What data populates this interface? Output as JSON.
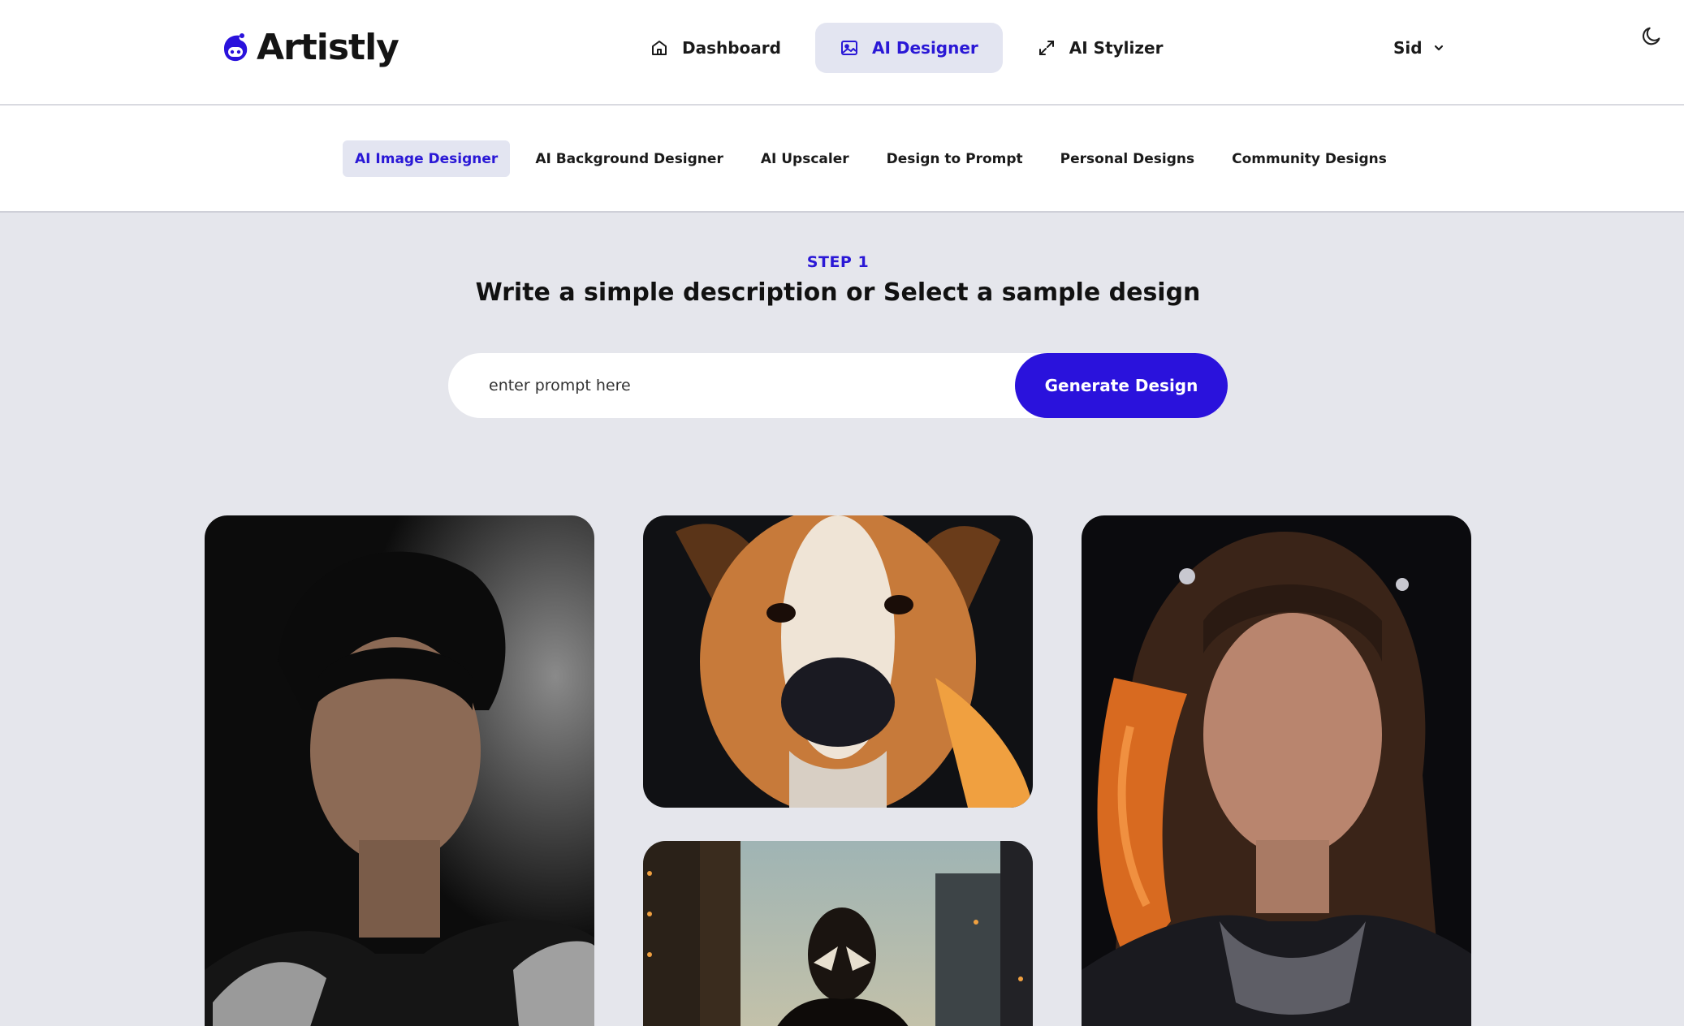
{
  "brand": {
    "name": "Artistly",
    "accent": "#2a12dc"
  },
  "nav": {
    "items": [
      {
        "label": "Dashboard",
        "icon": "home-icon",
        "active": false
      },
      {
        "label": "AI Designer",
        "icon": "image-icon",
        "active": true
      },
      {
        "label": "AI Stylizer",
        "icon": "expand-icon",
        "active": false
      }
    ]
  },
  "user": {
    "name": "Sid",
    "icon": "chevron-down-icon"
  },
  "theme_toggle": {
    "icon": "moon-icon"
  },
  "subnav": {
    "items": [
      {
        "label": "AI Image Designer",
        "active": true
      },
      {
        "label": "AI Background Designer",
        "active": false
      },
      {
        "label": "AI Upscaler",
        "active": false
      },
      {
        "label": "Design to Prompt",
        "active": false
      },
      {
        "label": "Personal Designs",
        "active": false
      },
      {
        "label": "Community Designs",
        "active": false
      }
    ]
  },
  "step": {
    "label": "STEP 1",
    "title": "Write a simple description or Select a sample design"
  },
  "prompt": {
    "placeholder": "enter prompt here",
    "value": "",
    "button_label": "Generate Design"
  },
  "gallery": {
    "items": [
      {
        "subject": "portrait of a dark-haired man in ornate armor"
      },
      {
        "subject": "close-up of a dog in dramatic lighting"
      },
      {
        "subject": "masked hero in a city at dusk"
      },
      {
        "subject": "portrait of a woman with long wavy hair"
      }
    ]
  }
}
